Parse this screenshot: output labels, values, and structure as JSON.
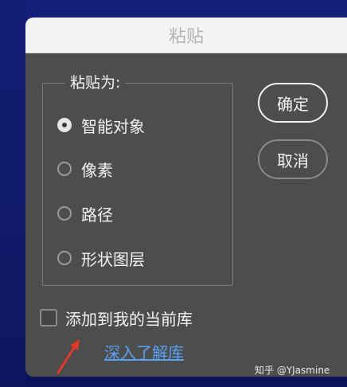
{
  "dialog": {
    "title": "粘贴",
    "group_label": "粘贴为:",
    "options": [
      {
        "label": "智能对象",
        "checked": true
      },
      {
        "label": "像素",
        "checked": false
      },
      {
        "label": "路径",
        "checked": false
      },
      {
        "label": "形状图层",
        "checked": false
      }
    ],
    "ok_label": "确定",
    "cancel_label": "取消",
    "checkbox_label": "添加到我的当前库",
    "checkbox_checked": false,
    "link_label": "深入了解库"
  },
  "watermark": "知乎 @YJasmine",
  "colors": {
    "dialog_bg": "#4d4d4d",
    "titlebar_bg": "#f4f4f4",
    "link": "#5aa0f0",
    "annotation_arrow": "#e03a2a",
    "desktop_bg": "#15207a"
  },
  "icons": {
    "annotation": "red-arrow-icon"
  }
}
